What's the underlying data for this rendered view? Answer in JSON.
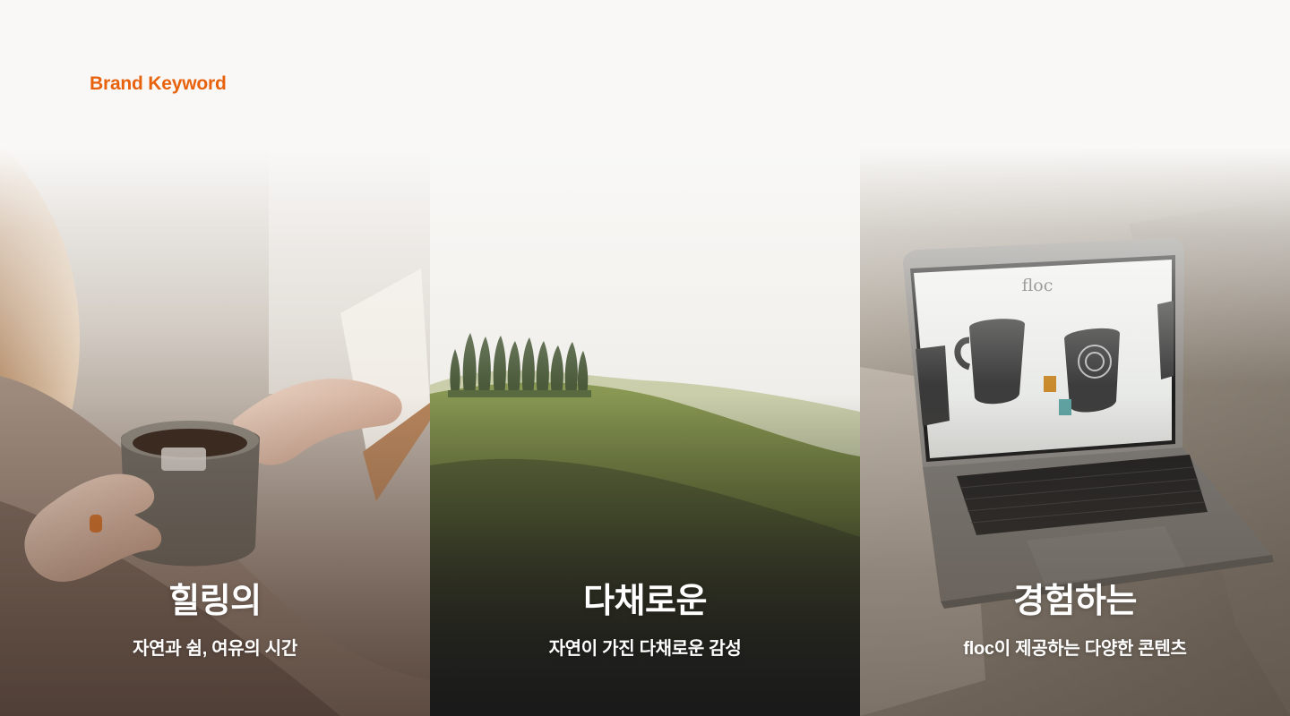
{
  "section": {
    "eyebrow": "Brand Keyword"
  },
  "panels": [
    {
      "title": "힐링의",
      "subtitle": "자연과 쉼, 여유의 시간",
      "image": "woman-holding-tea-cup-and-book-photo"
    },
    {
      "title": "다채로운",
      "subtitle": "자연이 가진 다채로운 감성",
      "image": "green-hills-with-cypress-trees-photo"
    },
    {
      "title": "경험하는",
      "subtitle": "floc이 제공하는 다양한 콘텐츠",
      "image": "laptop-showing-floc-mugs-photo",
      "screen_logo": "floc"
    }
  ],
  "colors": {
    "accent": "#e8620e",
    "background": "#f9f8f6",
    "caption": "#ffffff"
  }
}
